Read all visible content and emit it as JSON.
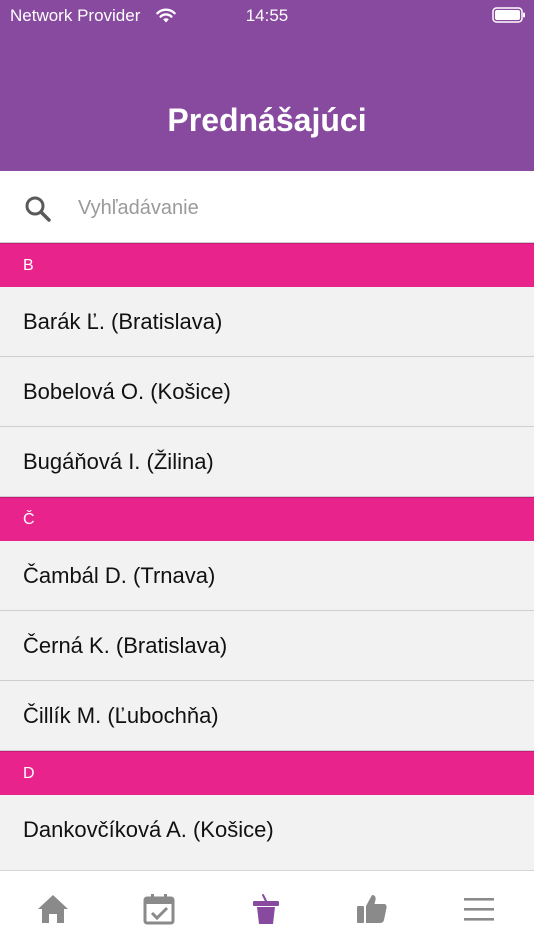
{
  "status_bar": {
    "carrier": "Network Provider",
    "time": "14:55"
  },
  "header": {
    "title": "Prednášajúci"
  },
  "search": {
    "placeholder": "Vyhľadávanie",
    "value": ""
  },
  "sections": [
    {
      "letter": "B",
      "items": [
        "Barák Ľ. (Bratislava)",
        "Bobelová O. (Košice)",
        "Bugáňová I. (Žilina)"
      ]
    },
    {
      "letter": "Č",
      "items": [
        "Čambál D. (Trnava)",
        "Černá K. (Bratislava)",
        "Čillík M. (Ľubochňa)"
      ]
    },
    {
      "letter": "D",
      "items": [
        "Dankovčíková A. (Košice)"
      ]
    }
  ],
  "tab_bar": {
    "tabs": [
      {
        "icon": "home-icon",
        "active": false
      },
      {
        "icon": "calendar-icon",
        "active": false
      },
      {
        "icon": "podium-icon",
        "active": true
      },
      {
        "icon": "thumbs-up-icon",
        "active": false
      },
      {
        "icon": "menu-icon",
        "active": false
      }
    ]
  },
  "colors": {
    "header": "#874a9f",
    "section": "#e8248c",
    "active_tab": "#874a9f",
    "inactive_tab": "#8a8a8a"
  }
}
